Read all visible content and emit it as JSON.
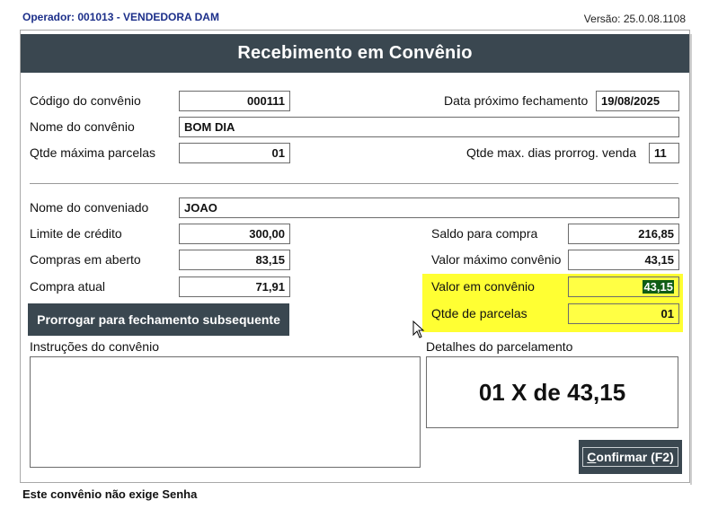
{
  "header": {
    "operator": "Operador: 001013 - VENDEDORA DAM",
    "version": "Versão: 25.0.08.1108"
  },
  "dialog": {
    "title": "Recebimento em Convênio"
  },
  "convenio": {
    "codigo_label": "Código do convênio",
    "codigo_value": "000111",
    "data_fechamento_label": "Data próximo fechamento",
    "data_fechamento_value": "19/08/2025",
    "nome_label": "Nome do convênio",
    "nome_value": "BOM DIA",
    "qtde_parcelas_label": "Qtde máxima parcelas",
    "qtde_parcelas_value": "01",
    "dias_prorrog_label": "Qtde max. dias prorrog. venda",
    "dias_prorrog_value": "11"
  },
  "conveniado": {
    "nome_label": "Nome do conveniado",
    "nome_value": "JOAO",
    "limite_label": "Limite de crédito",
    "limite_value": "300,00",
    "compras_aberto_label": "Compras em aberto",
    "compras_aberto_value": "83,15",
    "compra_atual_label": "Compra atual",
    "compra_atual_value": "71,91",
    "saldo_label": "Saldo para compra",
    "saldo_value": "216,85",
    "valor_maximo_label": "Valor máximo convênio",
    "valor_maximo_value": "43,15",
    "valor_convenio_label": "Valor em convênio",
    "valor_convenio_value": "43,15",
    "qtde_parcelas_label": "Qtde de parcelas",
    "qtde_parcelas_value": "01"
  },
  "buttons": {
    "prorrogar_label": "Prorrogar para fechamento subsequente",
    "confirmar_underlined": "C",
    "confirmar_rest": "onfirmar (F2)"
  },
  "instrucoes": {
    "label": "Instruções do convênio",
    "value": ""
  },
  "detalhes": {
    "label": "Detalhes do parcelamento",
    "value": "01 X de 43,15"
  },
  "footer": {
    "note": "Este convênio não exige Senha"
  },
  "colors": {
    "title_bar": "#3a4750",
    "highlight": "#ffff33",
    "operator_text": "#1c2f8a",
    "selection": "#0f5d15"
  }
}
